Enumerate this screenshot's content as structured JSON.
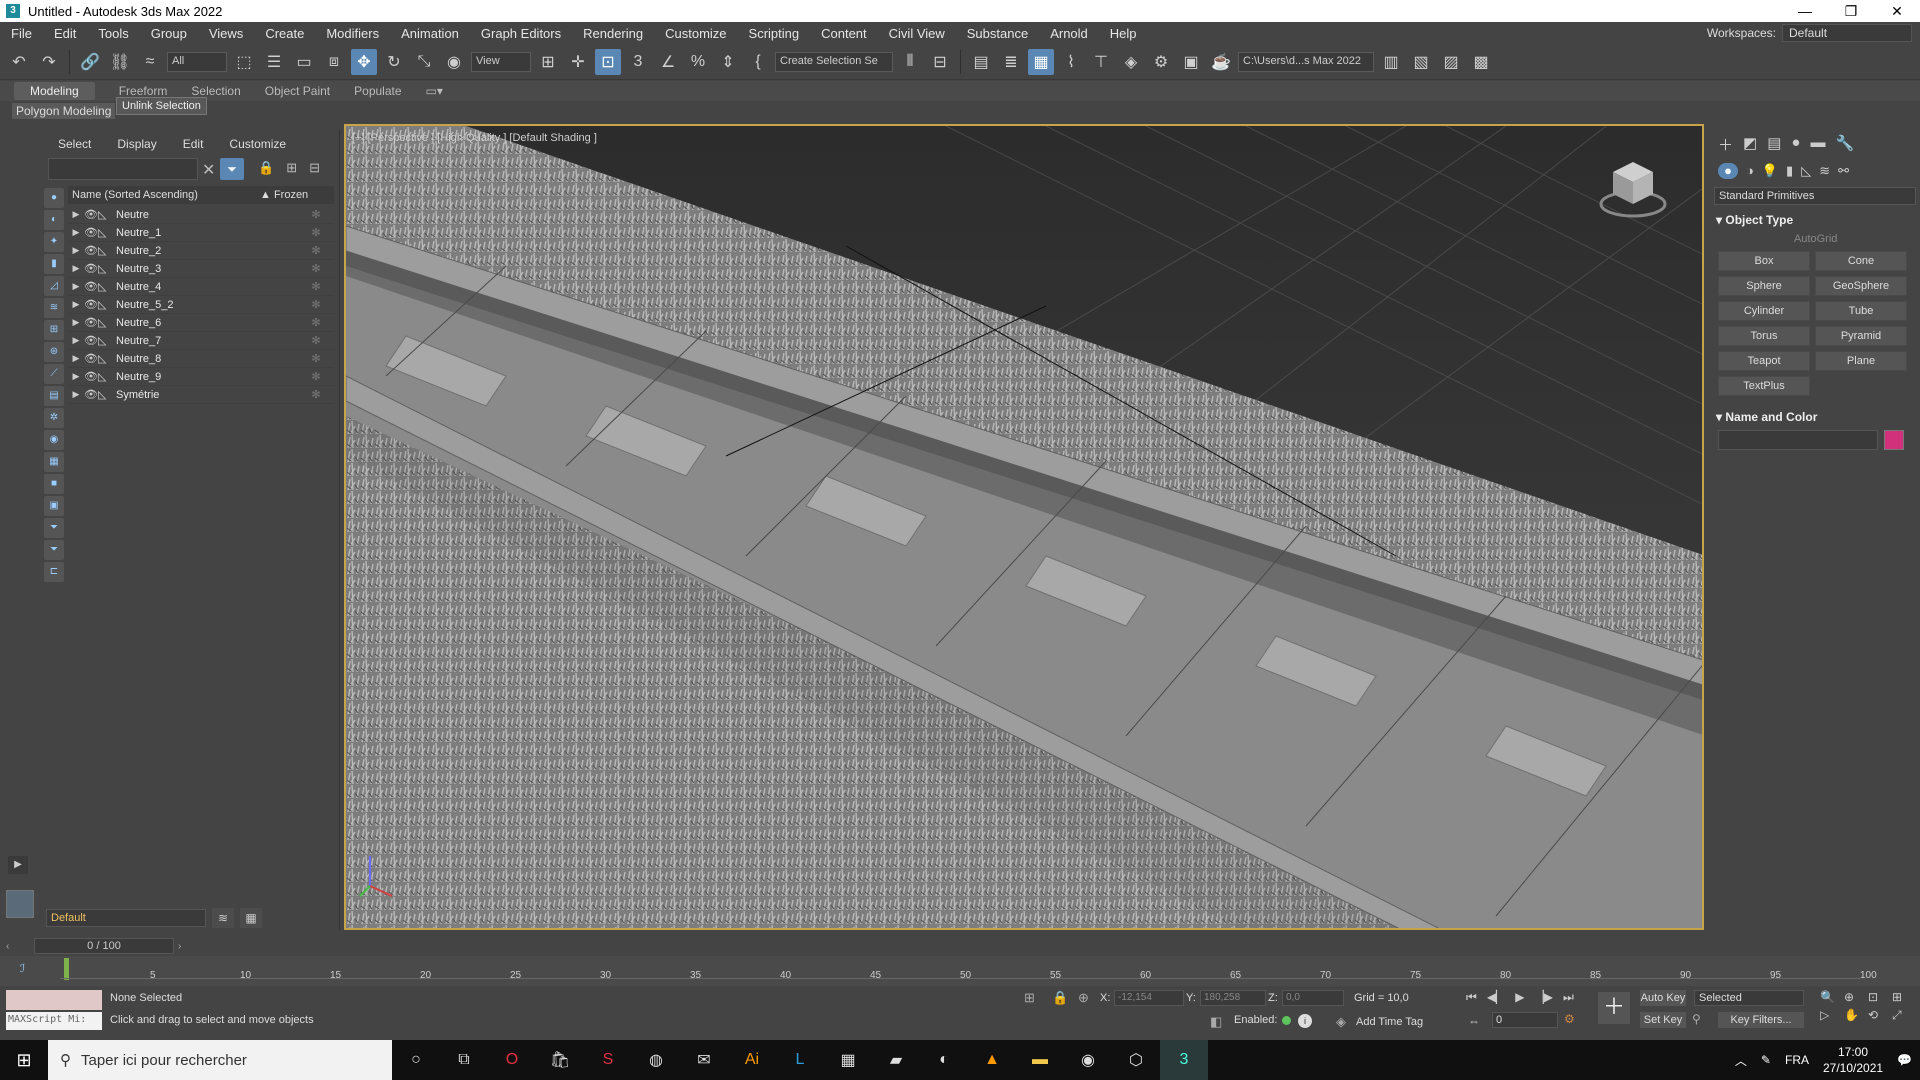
{
  "titlebar": {
    "title": "Untitled - Autodesk 3ds Max 2022",
    "minimize": "—",
    "restore": "❐",
    "close": "✕"
  },
  "menubar": {
    "items": [
      "File",
      "Edit",
      "Tools",
      "Group",
      "Views",
      "Create",
      "Modifiers",
      "Animation",
      "Graph Editors",
      "Rendering",
      "Customize",
      "Scripting",
      "Content",
      "Civil View",
      "Substance",
      "Arnold",
      "Help"
    ],
    "workspaces_label": "Workspaces:",
    "workspaces_value": "Default"
  },
  "toolbar": {
    "selection_filter": "All",
    "ref_coord": "View",
    "named_selection": "Create Selection Se",
    "project_path": "C:\\Users\\d...s Max 2022"
  },
  "ribbon": {
    "tabs": [
      "Modeling",
      "Freeform",
      "Selection",
      "Object Paint",
      "Populate"
    ],
    "active_tab": "Modeling",
    "sub_label": "Polygon Modeling",
    "tooltip": "Unlink Selection"
  },
  "scene_explorer": {
    "tabs": [
      "Select",
      "Display",
      "Edit",
      "Customize"
    ],
    "col_name": "Name (Sorted Ascending)",
    "col_frozen": "▲ Frozen",
    "rows": [
      "Neutre",
      "Neutre_1",
      "Neutre_2",
      "Neutre_3",
      "Neutre_4",
      "Neutre_5_2",
      "Neutre_6",
      "Neutre_7",
      "Neutre_8",
      "Neutre_9",
      "Symétrie"
    ],
    "layer": "Default"
  },
  "viewport": {
    "label": "[+] [Perspective ] [High Quality ] [Default Shading ]"
  },
  "command_panel": {
    "dropdown": "Standard Primitives",
    "rollout_object_type": "Object Type",
    "autogrid": "AutoGrid",
    "buttons": [
      "Box",
      "Cone",
      "Sphere",
      "GeoSphere",
      "Cylinder",
      "Tube",
      "Torus",
      "Pyramid",
      "Teapot",
      "Plane",
      "TextPlus"
    ],
    "rollout_name_color": "Name and Color",
    "swatch_color": "#d1307a"
  },
  "timeline": {
    "frame_display": "0 / 100",
    "ticks": [
      "5",
      "10",
      "15",
      "20",
      "25",
      "30",
      "35",
      "40",
      "45",
      "50",
      "55",
      "60",
      "65",
      "70",
      "75",
      "80",
      "85",
      "90",
      "95",
      "100"
    ]
  },
  "status": {
    "maxscript": "MAXScript Mi:",
    "selection": "None Selected",
    "prompt": "Click and drag to select and move objects",
    "x_label": "X:",
    "x_value": "-12,154",
    "y_label": "Y:",
    "y_value": "180,258",
    "z_label": "Z:",
    "z_value": "0,0",
    "grid": "Grid = 10,0",
    "enabled": "Enabled:",
    "add_time_tag": "Add Time Tag",
    "auto_key": "Auto Key",
    "set_key": "Set Key",
    "selected": "Selected",
    "key_filters": "Key Filters...",
    "frame": "0"
  },
  "taskbar": {
    "search": "Taper ici pour rechercher",
    "lang": "FRA",
    "time": "17:00",
    "date": "27/10/2021"
  }
}
